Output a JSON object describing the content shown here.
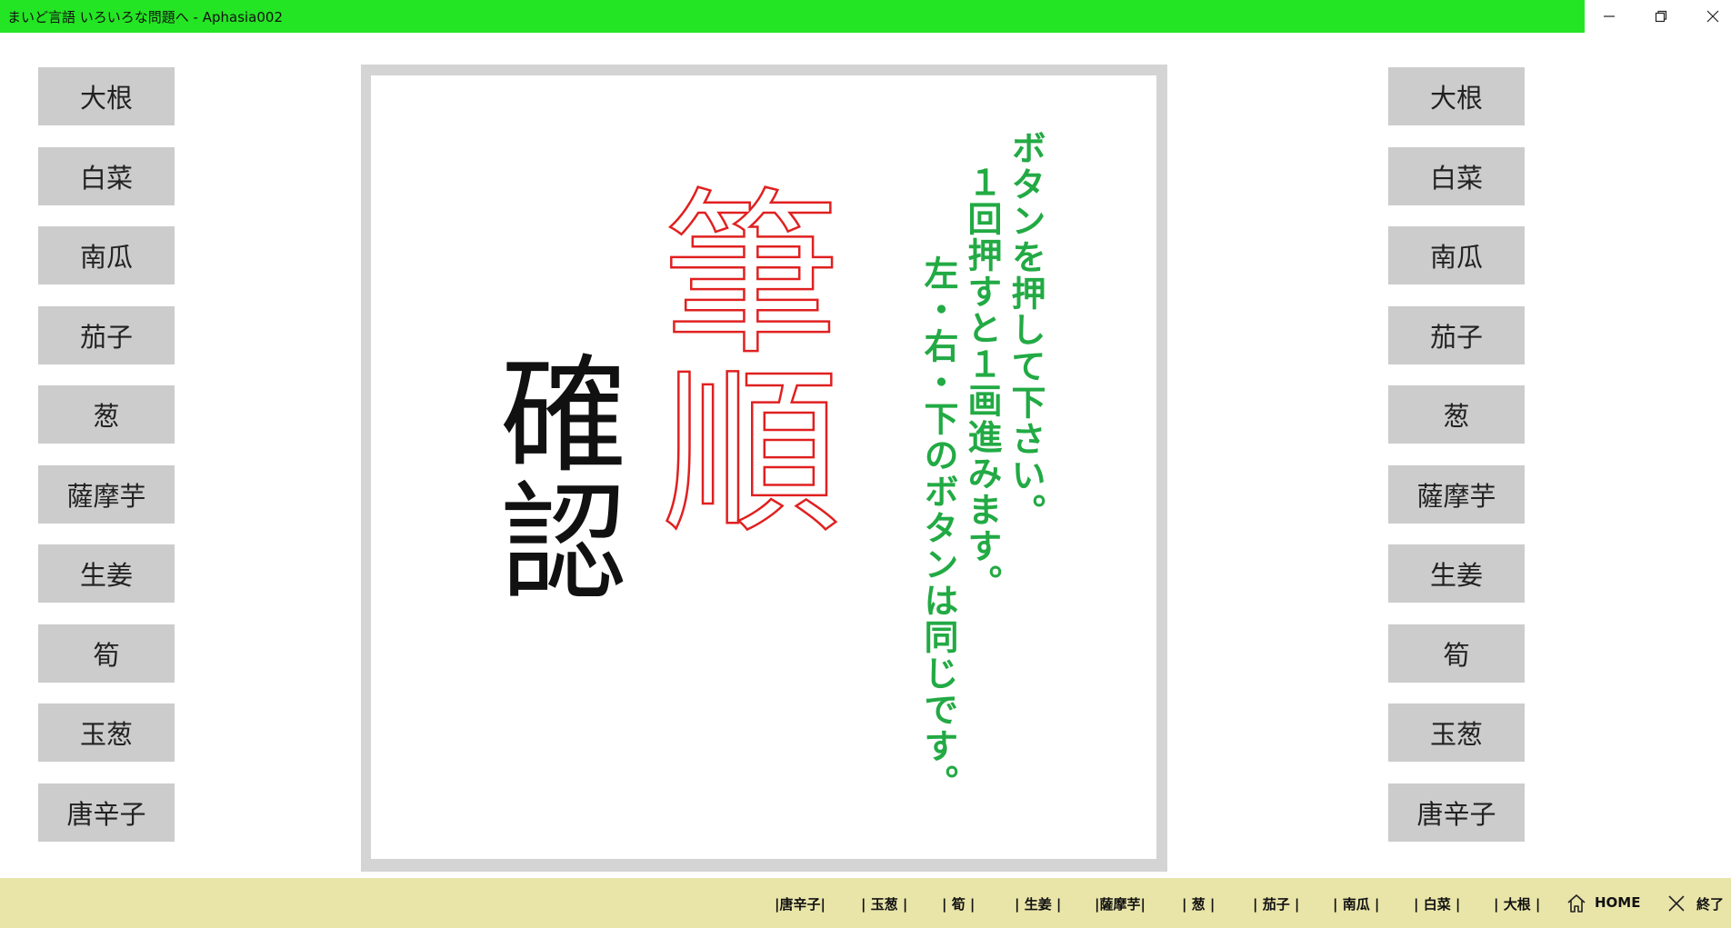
{
  "window": {
    "title": "まいど言語 いろいろな問題へ - Aphasia002",
    "minimize_glyph": "—",
    "restore_glyph": "❐",
    "close_glyph": "✕"
  },
  "left_buttons": [
    "大根",
    "白菜",
    "南瓜",
    "茄子",
    "葱",
    "薩摩芋",
    "生姜",
    "筍",
    "玉葱",
    "唐辛子"
  ],
  "right_buttons": [
    "大根",
    "白菜",
    "南瓜",
    "茄子",
    "葱",
    "薩摩芋",
    "生姜",
    "筍",
    "玉葱",
    "唐辛子"
  ],
  "canvas": {
    "big_text": "筆順",
    "confirm_text": "確認",
    "instructions": {
      "line1": "ボタンを押して下さい。",
      "line2": "１回押すと１画進みます。",
      "line3": "左・右・下のボタンは同じです。"
    }
  },
  "bottom_bar": {
    "items": [
      "|唐辛子|",
      "| 玉葱 |",
      "| 筍 |",
      "| 生姜 |",
      "|薩摩芋|",
      "| 葱 |",
      "| 茄子 |",
      "| 南瓜 |",
      "| 白菜 |",
      "| 大根 |"
    ],
    "home_label": "HOME",
    "exit_label": "終了"
  },
  "colors": {
    "title_bar": "#24e524",
    "button_bg": "#cccccc",
    "stroke_red": "#e02020",
    "instruction_green": "#22aa44",
    "bottom_bar": "#e9e5a9"
  }
}
